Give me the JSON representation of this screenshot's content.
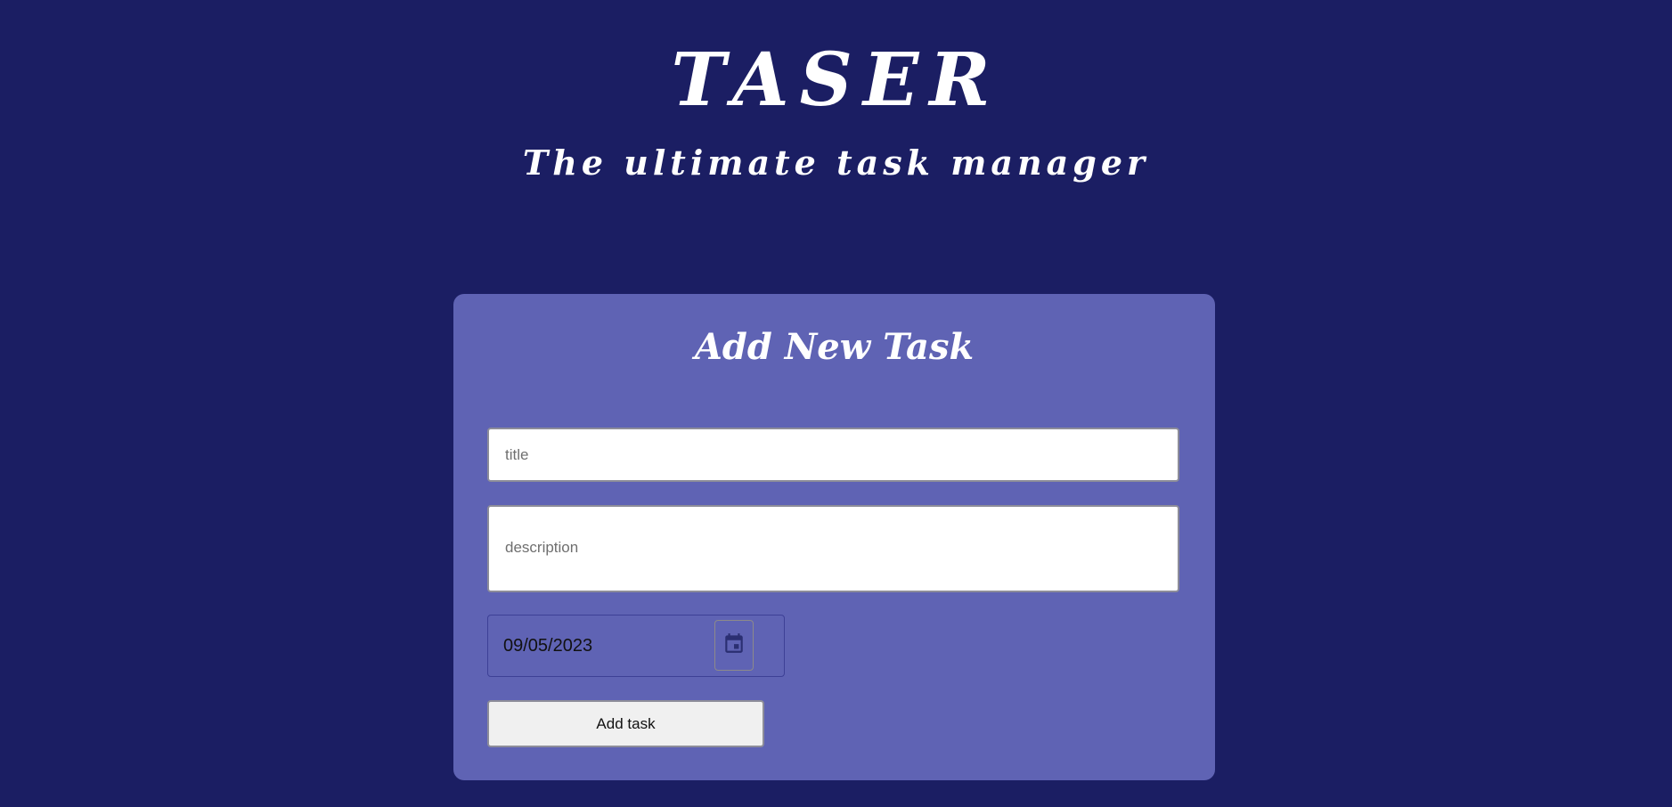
{
  "header": {
    "title": "TASER",
    "subtitle": "The ultimate task manager"
  },
  "form": {
    "heading": "Add New Task",
    "title_placeholder": "title",
    "description_placeholder": "description",
    "date_value": "09/05/2023",
    "submit_label": "Add task"
  },
  "icons": {
    "calendar": "calendar-icon"
  },
  "colors": {
    "page_background": "#1b1e63",
    "card_background": "#5f63b4",
    "icon_color": "#2b2f72"
  }
}
